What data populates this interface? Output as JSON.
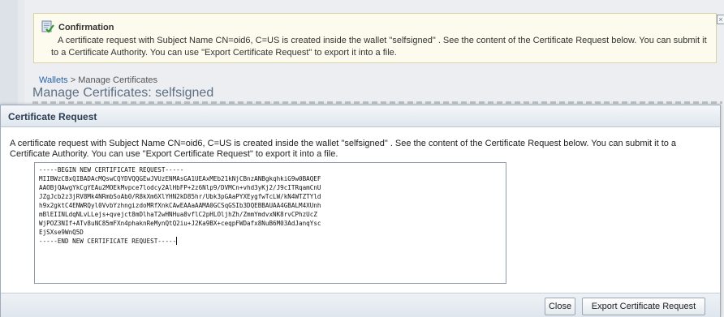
{
  "confirmation": {
    "title": "Confirmation",
    "message": "A certificate request with Subject Name CN=oid6, C=US is created inside the wallet \"selfsigned\" . See the content of the Certificate Request below. You can submit it to a Certificate Authority. You can use \"Export Certificate Request\" to export it into a file.",
    "icon": "confirmation-check-icon"
  },
  "breadcrumb": {
    "link": "Wallets",
    "separator": " > ",
    "current": "Manage Certificates"
  },
  "page": {
    "title": "Manage Certificates: selfsigned"
  },
  "dialog": {
    "title": "Certificate Request",
    "message": "A certificate request with Subject Name CN=oid6, C=US is created inside the wallet \"selfsigned\" . See the content of the Certificate Request below. You can submit it to a Certificate Authority. You can use \"Export Certificate Request\" to export it into a file.",
    "certificate_text": "-----BEGIN NEW CERTIFICATE REQUEST-----\nMIIBWzCBxQIBADAcMQswCQYDVQQGEwJVUzENMAsGA1UEAxMEb21kNjCBnzANBgkqhkiG9w0BAQEF\nAAOBjQAwgYkCgYEAu2MOEkMvpce7lodcy2AlHbFP+2z6Nlp9/DVMCn+vhd3yKj2/J9cITRqamCnU\nJZgJcb2z3jRV8Mk4NRmbSoAb0/R8kXm6XlYHN2kD85hr/Ubk3pGAaPYXEygfwTcLW/kN4WTZTYld\nh9x2gktC4ENWRQyl0VvbYzhngizdoMRfXnkCAwEAAaAAMA0GCSqGSIb3DQEBBAUAA4GBALM4XUnh\nmBlEIINLdqNLvLLejs+qvejct8mDlhaT2wHNHua8vflC2pHLOljhZh/ZmmYmdvxNK8rvCPhzUcZ\nWjPOZ3NIf+ATv8uNC85mFXn4phaknReMynQtQ2iu+J2Ka9BX+ceqpFWDafx8NuB6M03AdJanqYsc\nEjSXse9WnQ5D\n-----END NEW CERTIFICATE REQUEST-----",
    "buttons": {
      "close": "Close",
      "export": "Export Certificate Request"
    }
  }
}
